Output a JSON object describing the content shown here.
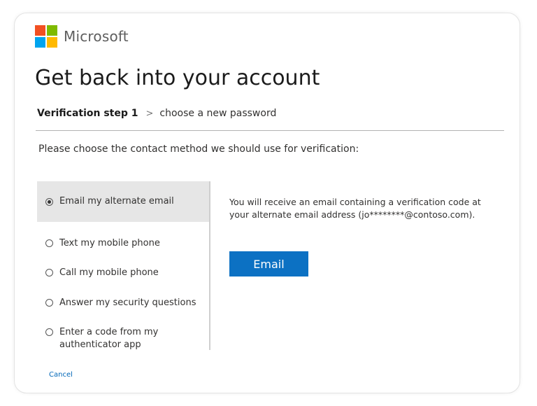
{
  "brand": {
    "name": "Microsoft",
    "logo_colors": [
      "#f25022",
      "#7fba00",
      "#00a4ef",
      "#ffb900"
    ]
  },
  "page": {
    "title": "Get back into your account"
  },
  "breadcrumb": {
    "current": "Verification step 1",
    "separator": ">",
    "next": "choose a new password"
  },
  "instruction": "Please choose the contact method we should use for verification:",
  "options": [
    {
      "label": "Email my alternate email",
      "selected": true
    },
    {
      "label": "Text my mobile phone",
      "selected": false
    },
    {
      "label": "Call my mobile phone",
      "selected": false
    },
    {
      "label": "Answer my security questions",
      "selected": false
    },
    {
      "label": "Enter a code from my authenticator app",
      "selected": false
    }
  ],
  "detail": {
    "text": "You will receive an email containing a verification code at your alternate email address (jo********@contoso.com)."
  },
  "actions": {
    "email_button": "Email",
    "cancel_link": "Cancel"
  },
  "colors": {
    "accent": "#0c71c3",
    "link": "#0067b8",
    "selected_bg": "#e6e6e6"
  }
}
